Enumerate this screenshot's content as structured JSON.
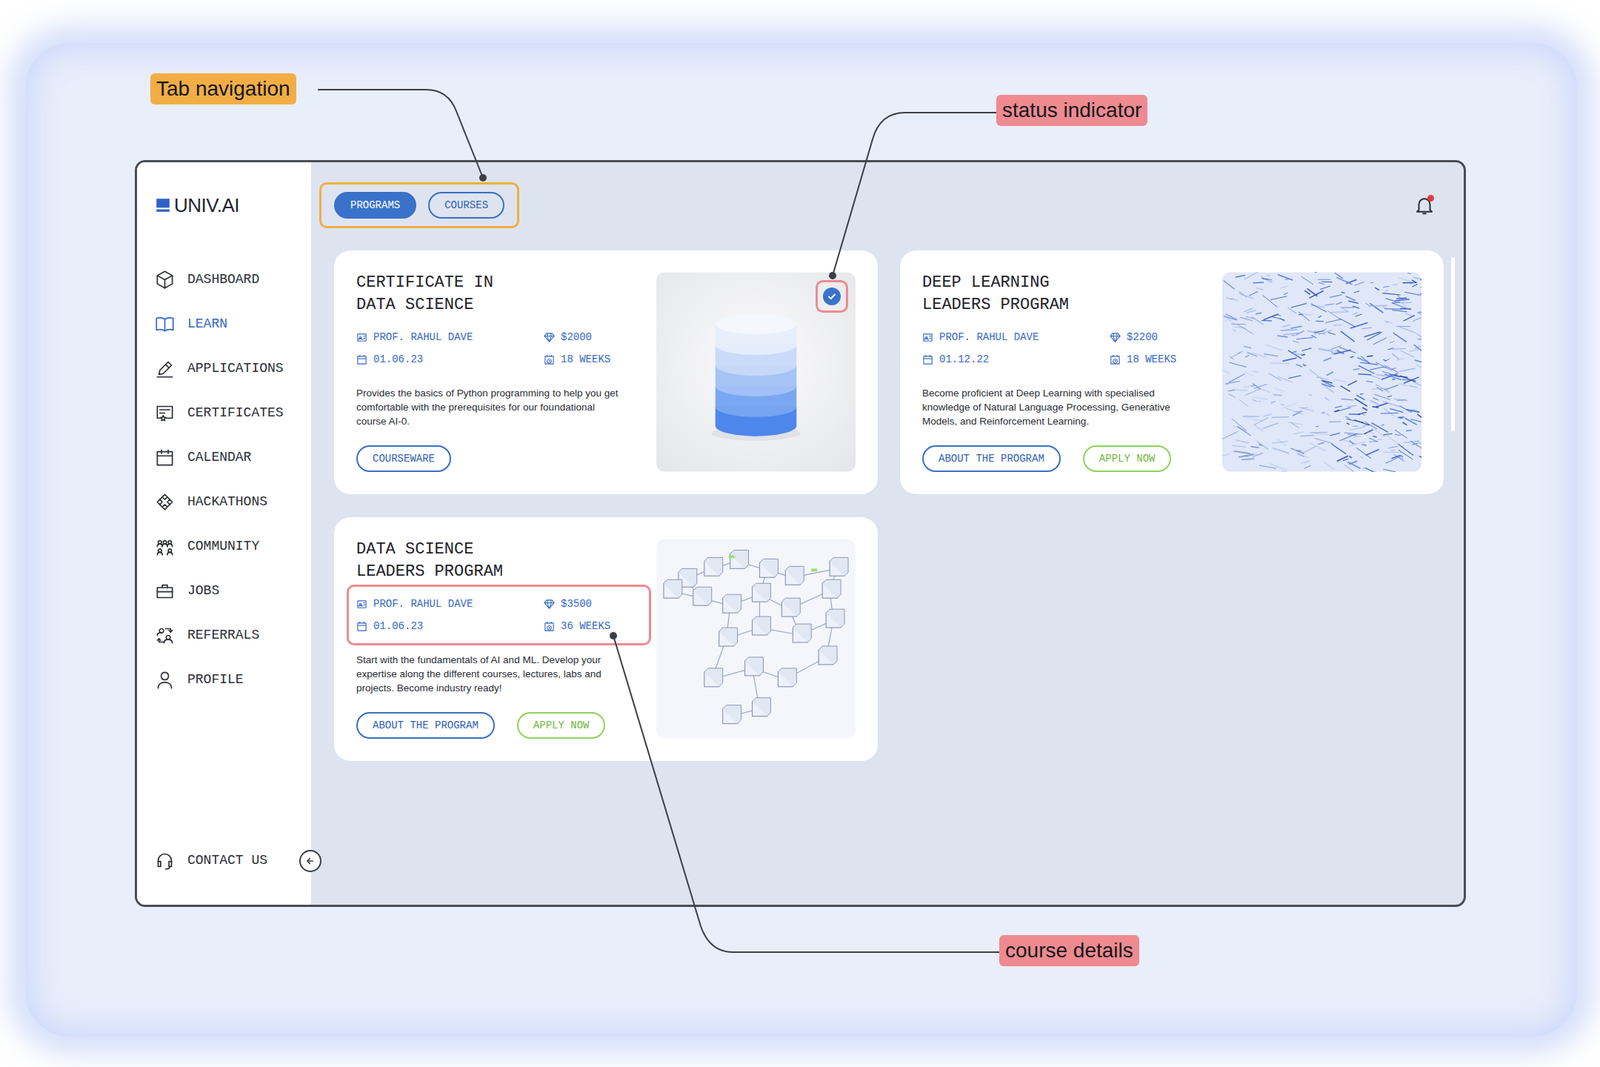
{
  "annotations": [
    {
      "label": "Tab navigation",
      "kind": "tabs",
      "color": "#f2ad45"
    },
    {
      "label": "status indicator",
      "kind": "status",
      "color": "#ef8a90"
    },
    {
      "label": "course details",
      "kind": "details",
      "color": "#ef8a90"
    }
  ],
  "app": {
    "logo": "UNIV.AI",
    "sidebar": {
      "items": [
        {
          "label": "DASHBOARD",
          "selected": false
        },
        {
          "label": "LEARN",
          "selected": true
        },
        {
          "label": "APPLICATIONS",
          "selected": false
        },
        {
          "label": "CERTIFICATES",
          "selected": false
        },
        {
          "label": "CALENDAR",
          "selected": false
        },
        {
          "label": "HACKATHONS",
          "selected": false
        },
        {
          "label": "COMMUNITY",
          "selected": false
        },
        {
          "label": "JOBS",
          "selected": false
        },
        {
          "label": "REFERRALS",
          "selected": false
        },
        {
          "label": "PROFILE",
          "selected": false
        }
      ],
      "footer": "CONTACT US"
    },
    "tabs": [
      {
        "label": "PROGRAMS",
        "selected": true
      },
      {
        "label": "COURSES",
        "selected": false
      }
    ],
    "notifications": {
      "unread": true
    },
    "cards": [
      {
        "title": [
          "CERTIFICATE IN",
          "DATA SCIENCE"
        ],
        "instructor": "PROF. RAHUL DAVE",
        "price": "$2000",
        "date": "01.06.23",
        "duration": "18 WEEKS",
        "description": "Provides the basics of Python programming to help you get comfortable with the prerequisites for our foundational course AI-0.",
        "buttons": [
          {
            "label": "COURSEWARE",
            "kind": "outline"
          }
        ],
        "image": "cylinder",
        "completed": true,
        "highlight": "status"
      },
      {
        "title": [
          "DEEP LEARNING",
          "LEADERS PROGRAM"
        ],
        "instructor": "PROF. RAHUL DAVE",
        "price": "$2200",
        "date": "01.12.22",
        "duration": "18 WEEKS",
        "description": "Become proficient at Deep Learning with specialised knowledge of Natural Language Processing, Generative Models, and Reinforcement Learning.",
        "buttons": [
          {
            "label": "ABOUT THE PROGRAM",
            "kind": "outline"
          },
          {
            "label": "APPLY NOW",
            "kind": "apply"
          }
        ],
        "image": "texture",
        "completed": false,
        "highlight": "none"
      },
      {
        "title": [
          "DATA SCIENCE",
          "LEADERS PROGRAM"
        ],
        "instructor": "PROF. RAHUL DAVE",
        "price": "$3500",
        "date": "01.06.23",
        "duration": "36 WEEKS",
        "description": "Start with the fundamentals of AI and ML. Develop your expertise along the different courses, lectures, labs and projects. Become industry ready!",
        "buttons": [
          {
            "label": "ABOUT THE PROGRAM",
            "kind": "outline"
          },
          {
            "label": "APPLY NOW",
            "kind": "apply"
          }
        ],
        "image": "network",
        "completed": false,
        "highlight": "details"
      }
    ]
  }
}
